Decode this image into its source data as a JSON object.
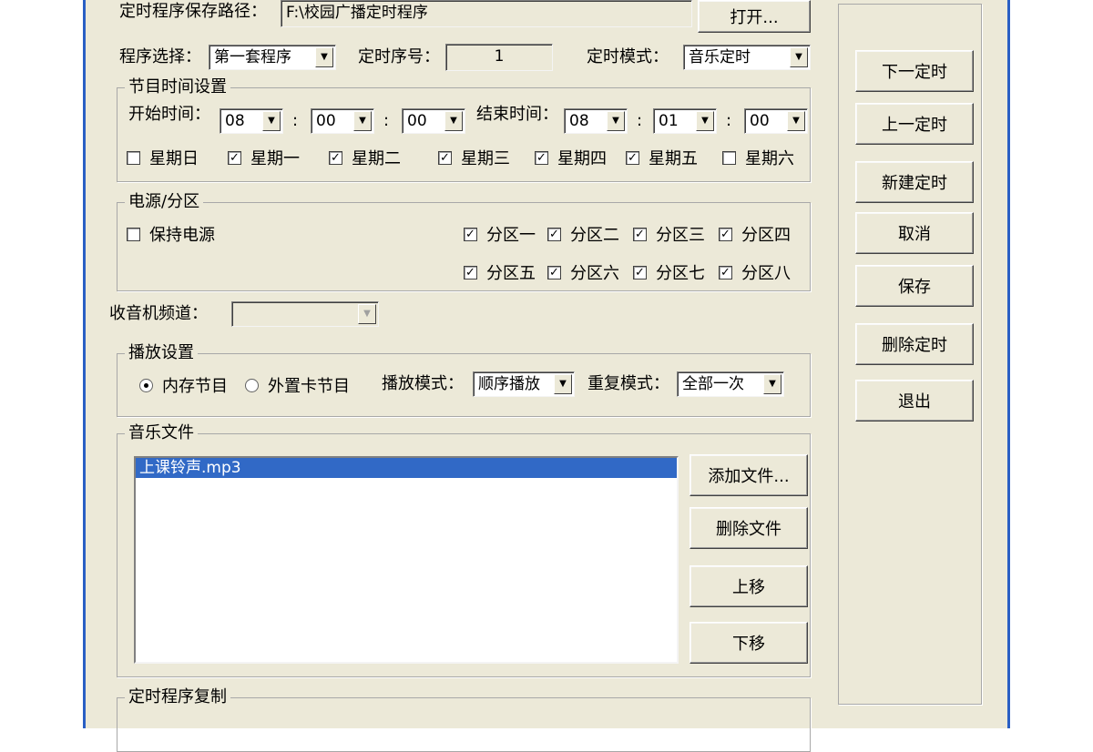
{
  "path": {
    "label": "定时程序保存路径：",
    "value": "F:\\校园广播定时程序",
    "open_button": "打开..."
  },
  "program": {
    "label": "程序选择：",
    "value": "第一套程序",
    "seq_label": "定时序号：",
    "seq_value": "1",
    "mode_label": "定时模式：",
    "mode_value": "音乐定时"
  },
  "time": {
    "group_title": "节目时间设置",
    "start_label": "开始时间：",
    "start_h": "08",
    "start_m": "00",
    "start_s": "00",
    "end_label": "结束时间：",
    "end_h": "08",
    "end_m": "01",
    "end_s": "00",
    "sep": ":",
    "weekdays": [
      {
        "label": "星期日",
        "checked": false
      },
      {
        "label": "星期一",
        "checked": true
      },
      {
        "label": "星期二",
        "checked": true
      },
      {
        "label": "星期三",
        "checked": true
      },
      {
        "label": "星期四",
        "checked": true
      },
      {
        "label": "星期五",
        "checked": true
      },
      {
        "label": "星期六",
        "checked": false
      }
    ]
  },
  "power": {
    "group_title": "电源/分区",
    "keep_power": {
      "label": "保持电源",
      "checked": false
    },
    "zones": [
      {
        "label": "分区一",
        "checked": true
      },
      {
        "label": "分区二",
        "checked": true
      },
      {
        "label": "分区三",
        "checked": true
      },
      {
        "label": "分区四",
        "checked": true
      },
      {
        "label": "分区五",
        "checked": true
      },
      {
        "label": "分区六",
        "checked": true
      },
      {
        "label": "分区七",
        "checked": true
      },
      {
        "label": "分区八",
        "checked": true
      }
    ]
  },
  "radio": {
    "label": "收音机频道：",
    "value": ""
  },
  "play": {
    "group_title": "播放设置",
    "source_internal": "内存节目",
    "source_external": "外置卡节目",
    "mode_label": "播放模式：",
    "mode_value": "顺序播放",
    "repeat_label": "重复模式：",
    "repeat_value": "全部一次"
  },
  "music": {
    "group_title": "音乐文件",
    "files": [
      "上课铃声.mp3"
    ],
    "add_button": "添加文件...",
    "delete_button": "删除文件",
    "up_button": "上移",
    "down_button": "下移"
  },
  "copy": {
    "group_title": "定时程序复制"
  },
  "side": {
    "next": "下一定时",
    "prev": "上一定时",
    "new": "新建定时",
    "cancel": "取消",
    "save": "保存",
    "delete": "删除定时",
    "exit": "退出"
  },
  "icons": {
    "dropdown": "chevron-down-icon",
    "check": "check-icon"
  }
}
